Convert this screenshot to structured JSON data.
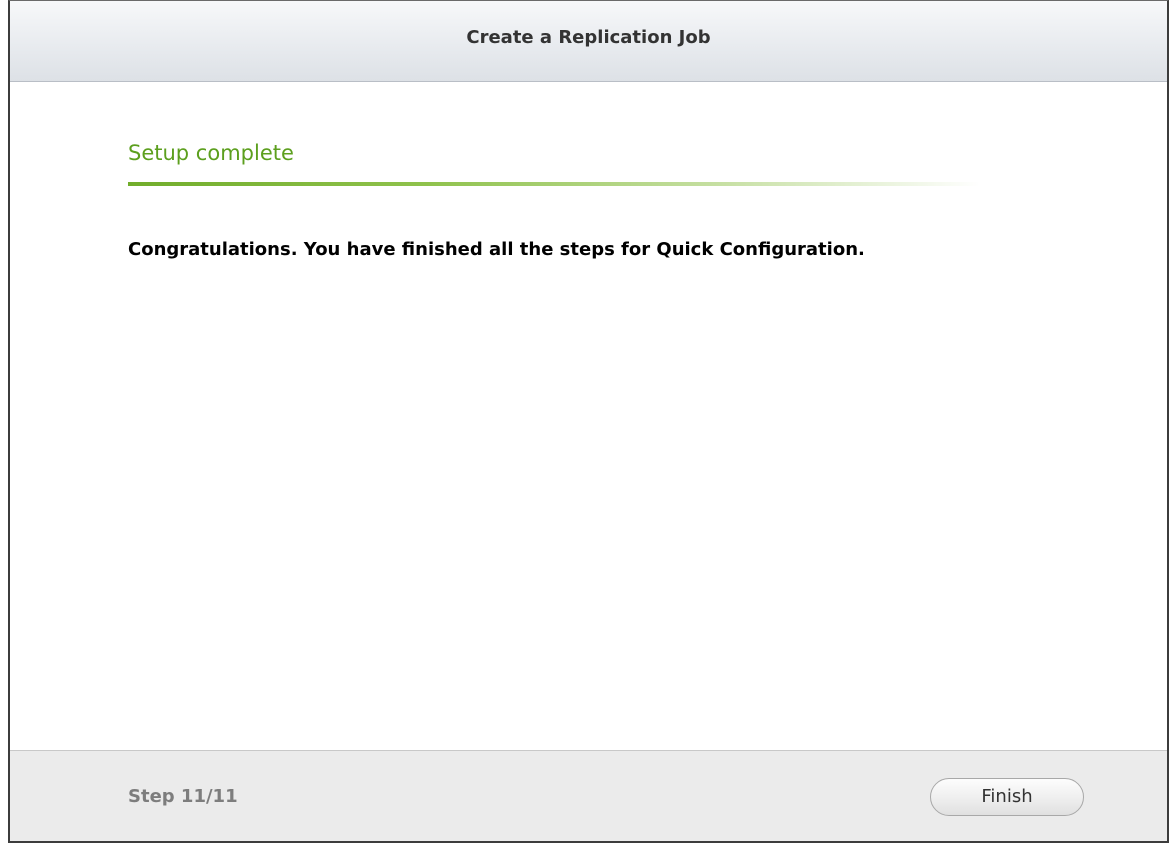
{
  "dialog": {
    "title": "Create a Replication Job"
  },
  "content": {
    "heading": "Setup complete",
    "message": "Congratulations. You have finished all the steps for Quick Configuration."
  },
  "footer": {
    "step_label": "Step 11/11",
    "finish_label": "Finish"
  },
  "colors": {
    "heading_accent": "#5c9f1e",
    "step_text": "#7d7d7d"
  }
}
